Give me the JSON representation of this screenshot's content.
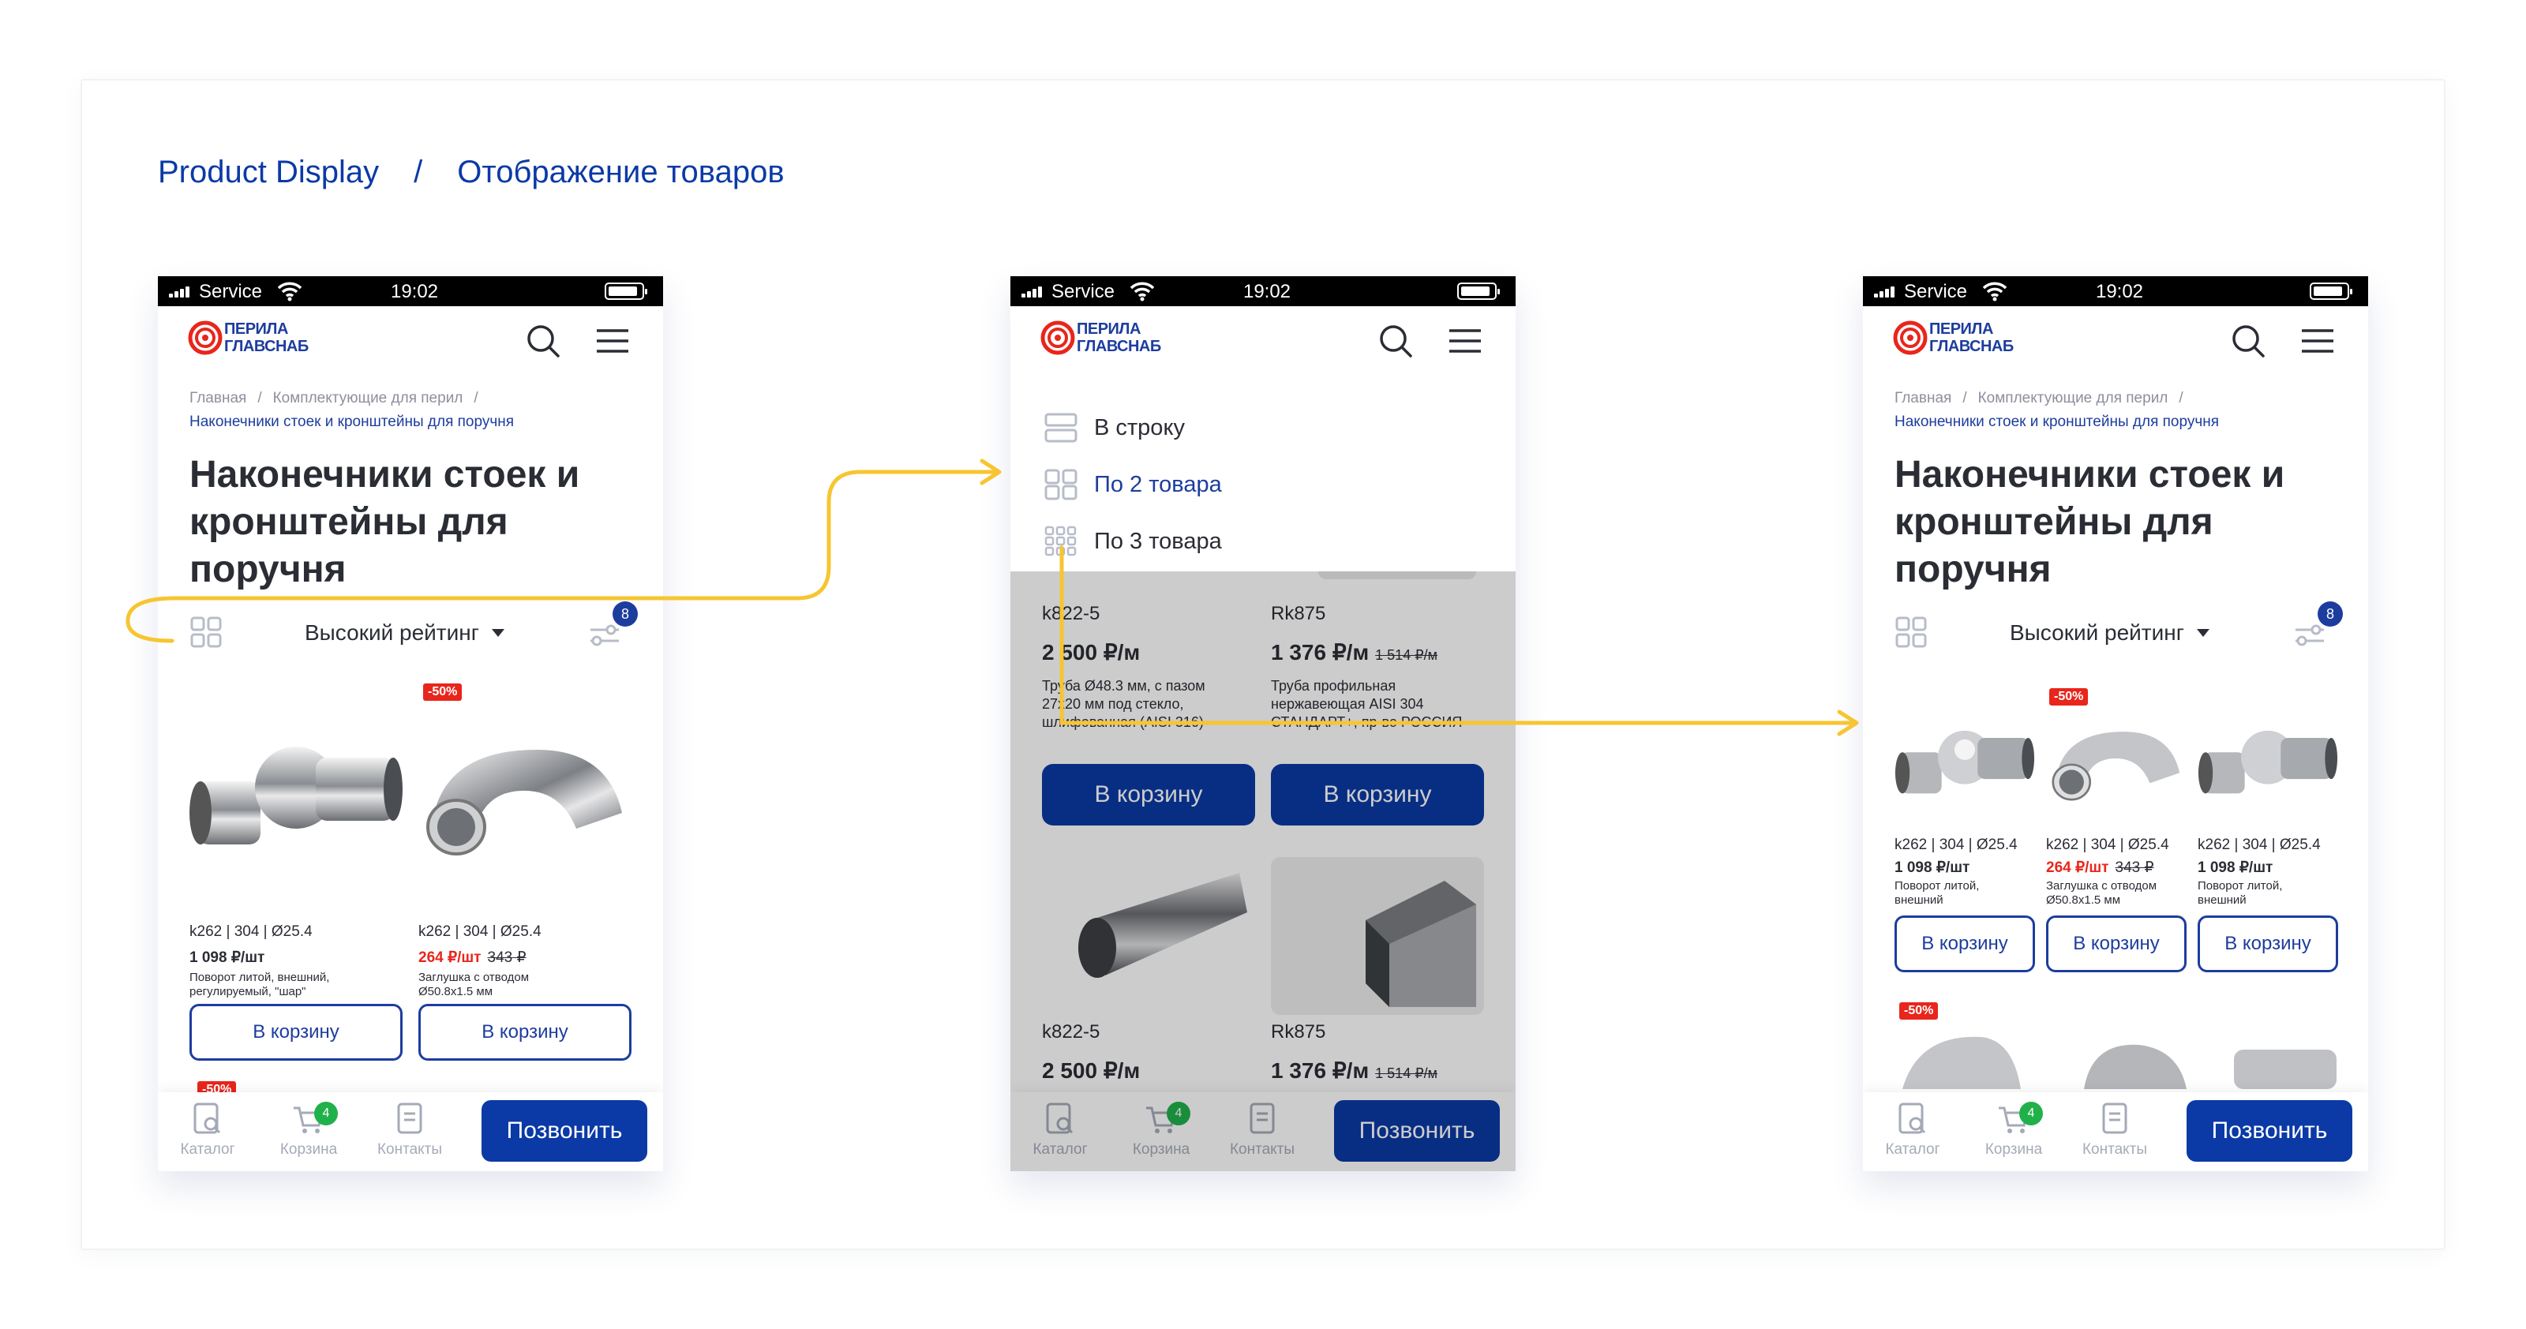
{
  "breadcrumb": {
    "left": "Product Display",
    "separator": "/",
    "right": "Отображение товаров"
  },
  "colors": {
    "brand": "#0b3aa6",
    "accent_arrow": "#f7c531",
    "sale": "#e8261c",
    "badge_green": "#21b14b"
  },
  "status": {
    "carrier": "Service",
    "time": "19:02"
  },
  "logo": {
    "line1": "ПЕРИЛА",
    "line2": "ГЛАВСНАБ"
  },
  "page": {
    "crumb_home": "Главная",
    "crumb_sep": "/",
    "crumb_section": "Комплектующие для перил",
    "crumb_current": "Наконечники стоек и кронштейны для поручня",
    "title": "Наконечники стоек и кронштейны для поручня",
    "sort_label": "Высокий рейтинг",
    "filter_count": "8"
  },
  "nav": {
    "catalog": "Каталог",
    "cart": "Корзина",
    "cart_count": "4",
    "contacts": "Контакты",
    "call": "Позвонить"
  },
  "view_menu": {
    "row": "В строку",
    "two": "По 2 товара",
    "three": "По 3 товара"
  },
  "buy_label": "В корзину",
  "sale_tag": "-50%",
  "products": [
    {
      "sku": "k262",
      "grade": "304",
      "diameter": "Ø25.4",
      "price": "1 098 ₽/шт",
      "old_price": "",
      "desc": "Поворот литой, внешний, регулируемый, \"шар\"",
      "desc_short": "Поворот литой, внешний"
    },
    {
      "sku": "k262",
      "grade": "304",
      "diameter": "Ø25.4",
      "price": "264 ₽/шт",
      "old_price": "343 ₽",
      "desc": "Заглушка с отводом Ø50.8х1.5 мм"
    }
  ],
  "products_b": [
    {
      "sku": "k822-5",
      "price": "2 500 ₽/м",
      "old_price": "",
      "desc": "Труба Ø48.3 мм, с пазом 27х20 мм под стекло, шлифованная (AISI 316)"
    },
    {
      "sku": "Rk875",
      "price": "1 376 ₽/м",
      "old_price": "1 514 ₽/м",
      "desc": "Труба профильная нержавеющая AISI 304 СТАНДАРТ+, пр-во РОССИЯ"
    }
  ]
}
